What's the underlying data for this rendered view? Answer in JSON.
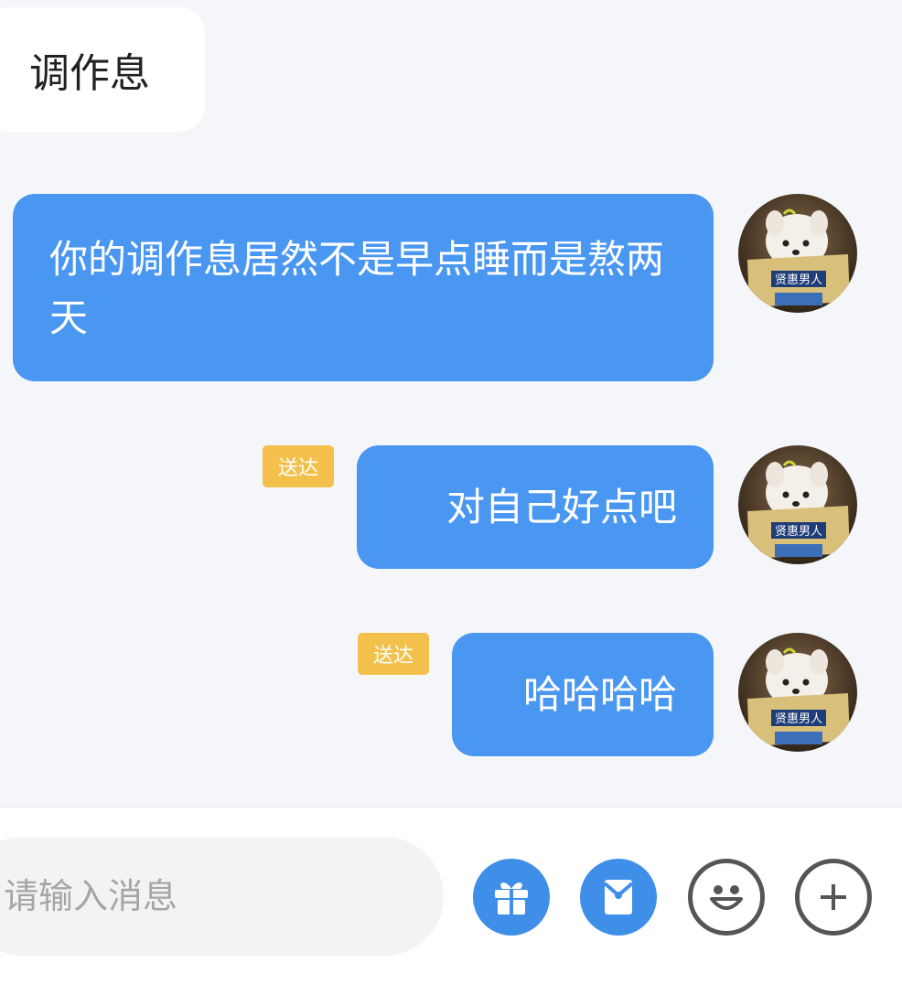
{
  "messages": [
    {
      "side": "in",
      "text": "调作息"
    },
    {
      "side": "out",
      "text": "你的调作息居然不是早点睡而是熬两天",
      "status": ""
    },
    {
      "side": "out",
      "text": "对自己好点吧",
      "status": "送达"
    },
    {
      "side": "out",
      "text": "哈哈哈哈",
      "status": "送达"
    }
  ],
  "input": {
    "placeholder": "请输入消息",
    "value": ""
  },
  "toolbar": {
    "icons": [
      "gift-icon",
      "red-packet-icon",
      "emoji-icon",
      "plus-icon"
    ]
  },
  "avatar": {
    "book_text": "贤惠男人"
  },
  "colors": {
    "bubble_out": "#4a97f2",
    "bubble_in": "#ffffff",
    "badge": "#f3c14b",
    "background": "#f4f6f9",
    "tool_blue": "#3f8fe9"
  }
}
